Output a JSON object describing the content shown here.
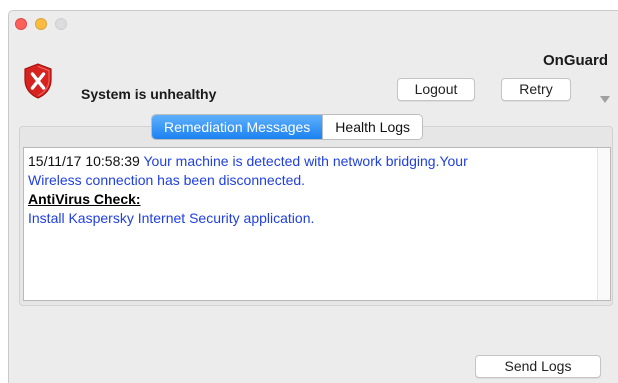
{
  "window": {
    "title": "OnGuard"
  },
  "status": {
    "text": "System is unhealthy",
    "icon": "shield-x-icon",
    "color": "#d7231f"
  },
  "header": {
    "logout_label": "Logout",
    "retry_label": "Retry"
  },
  "tabs": [
    {
      "label": "Remediation Messages",
      "active": true
    },
    {
      "label": "Health Logs",
      "active": false
    }
  ],
  "messages": {
    "timestamp": "15/11/17 10:58:39",
    "line1": "Your machine is detected with network bridging.Your",
    "line2": "Wireless connection has been disconnected.",
    "heading": "AntiVirus Check:",
    "line3": "Install Kaspersky Internet Security application."
  },
  "footer": {
    "send_logs_label": "Send Logs"
  },
  "colors": {
    "accent": "#1b82f2",
    "message_text": "#1f3fe0"
  }
}
